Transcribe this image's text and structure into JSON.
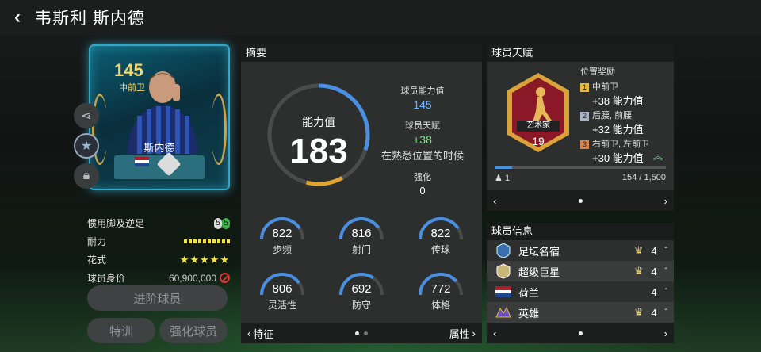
{
  "header": {
    "back_icon": "chevron-left-icon",
    "title": "韦斯利 斯内德"
  },
  "card": {
    "rating": "145",
    "position": "中前卫",
    "name": "斯内德",
    "nation_flag": "netherlands-flag",
    "colors": {
      "frame": "#2fa7c8",
      "rating": "#f3d56b"
    }
  },
  "side_buttons": [
    {
      "name": "share",
      "icon": "share-icon"
    },
    {
      "name": "favorite",
      "icon": "star-icon"
    },
    {
      "name": "lock",
      "icon": "lock-icon"
    }
  ],
  "attributes": {
    "foot_label": "惯用脚及逆足",
    "foot_values": [
      "5",
      "5"
    ],
    "stamina_label": "耐力",
    "stamina_bars": 10,
    "skill_label": "花式",
    "skill_stars": "★★★★★",
    "value_label": "球员身价",
    "value": "60,900,000"
  },
  "buttons": {
    "advance": "进阶球员",
    "train": "特训",
    "enhance": "强化球员"
  },
  "summary": {
    "title": "摘要",
    "overall_label": "能力值",
    "overall_value": "183",
    "overall_fraction": 0.72,
    "player_rating_label": "球员能力值",
    "player_rating_value": "145",
    "talent_label": "球员天赋",
    "talent_value": "+38",
    "talent_note": "在熟悉位置的时候",
    "enhance_label": "强化",
    "enhance_value": "0",
    "stats": [
      {
        "label": "步频",
        "value": "822",
        "fraction": 0.82
      },
      {
        "label": "射门",
        "value": "816",
        "fraction": 0.81
      },
      {
        "label": "传球",
        "value": "822",
        "fraction": 0.82
      },
      {
        "label": "灵活性",
        "value": "806",
        "fraction": 0.8
      },
      {
        "label": "防守",
        "value": "692",
        "fraction": 0.69
      },
      {
        "label": "体格",
        "value": "772",
        "fraction": 0.77
      }
    ],
    "footer_left": "特征",
    "footer_right": "属性"
  },
  "talent": {
    "title": "球员天赋",
    "badge_label": "艺术家",
    "badge_level": "19",
    "bonus_header": "位置奖励",
    "bonuses": [
      {
        "rank": "1",
        "positions": "中前卫",
        "bonus": "+38 能力值",
        "color": "#e7b93c"
      },
      {
        "rank": "2",
        "positions": "后腰, 前腰",
        "bonus": "+32 能力值",
        "color": "#a9b4c8"
      },
      {
        "rank": "3",
        "positions": "右前卫, 左前卫",
        "bonus": "+30 能力值",
        "color": "#d8824a"
      }
    ],
    "likes": "1",
    "progress_text": "154 / 1,500",
    "progress_fraction": 0.103
  },
  "info": {
    "title": "球员信息",
    "rows": [
      {
        "label": "足坛名宿",
        "icon": "legend-icon",
        "count": "4"
      },
      {
        "label": "超级巨星",
        "icon": "superstar-icon",
        "count": "4"
      },
      {
        "label": "荷兰",
        "icon": "netherlands-flag-icon",
        "count": "4"
      },
      {
        "label": "英雄",
        "icon": "hero-icon",
        "count": "4"
      }
    ]
  }
}
